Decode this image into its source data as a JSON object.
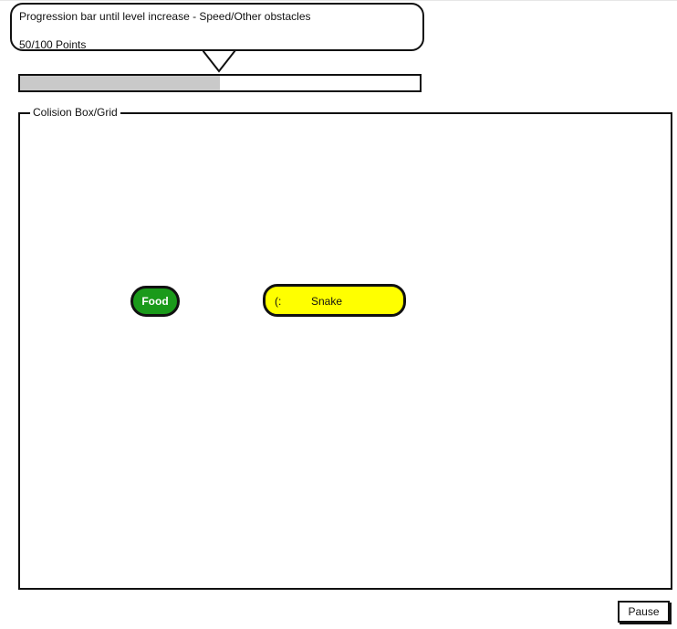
{
  "tooltip": {
    "line1": "Progression bar until level increase - Speed/Other obstacles",
    "line2": "50/100 Points"
  },
  "progress": {
    "points": 50,
    "max_points": 100,
    "fraction": 0.5,
    "fill_color": "#c9c9c9"
  },
  "game_area": {
    "label": "Colision Box/Grid"
  },
  "food": {
    "label": "Food",
    "color": "#1a9a1a"
  },
  "snake": {
    "face": "(:",
    "label": "Snake",
    "color": "#ffff00"
  },
  "controls": {
    "pause_label": "Pause"
  }
}
